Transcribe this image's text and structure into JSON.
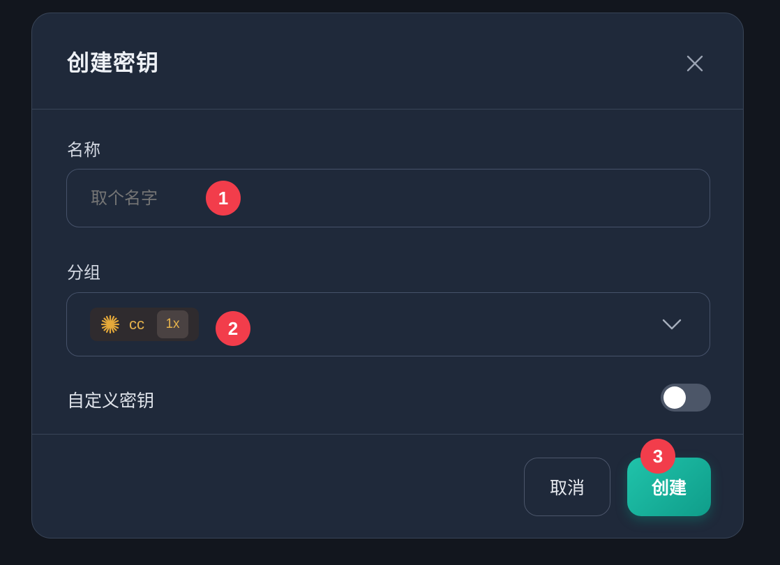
{
  "dialog": {
    "title": "创建密钥",
    "close_icon": "close-icon"
  },
  "name_field": {
    "label": "名称",
    "placeholder": "取个名字",
    "value": ""
  },
  "group_field": {
    "label": "分组",
    "selected": {
      "icon": "sparkle-icon",
      "name": "cc",
      "multiplier": "1x"
    },
    "dropdown_icon": "chevron-down-icon"
  },
  "custom_key": {
    "label": "自定义密钥",
    "enabled": false
  },
  "footer": {
    "cancel_label": "取消",
    "create_label": "创建"
  },
  "step_badges": {
    "one": "1",
    "two": "2",
    "three": "3"
  },
  "colors": {
    "dialog_bg": "#1f293a",
    "border": "#394558",
    "accent": "#20c3aa",
    "badge": "#f23d4b",
    "chip_text": "#e5b24c"
  }
}
